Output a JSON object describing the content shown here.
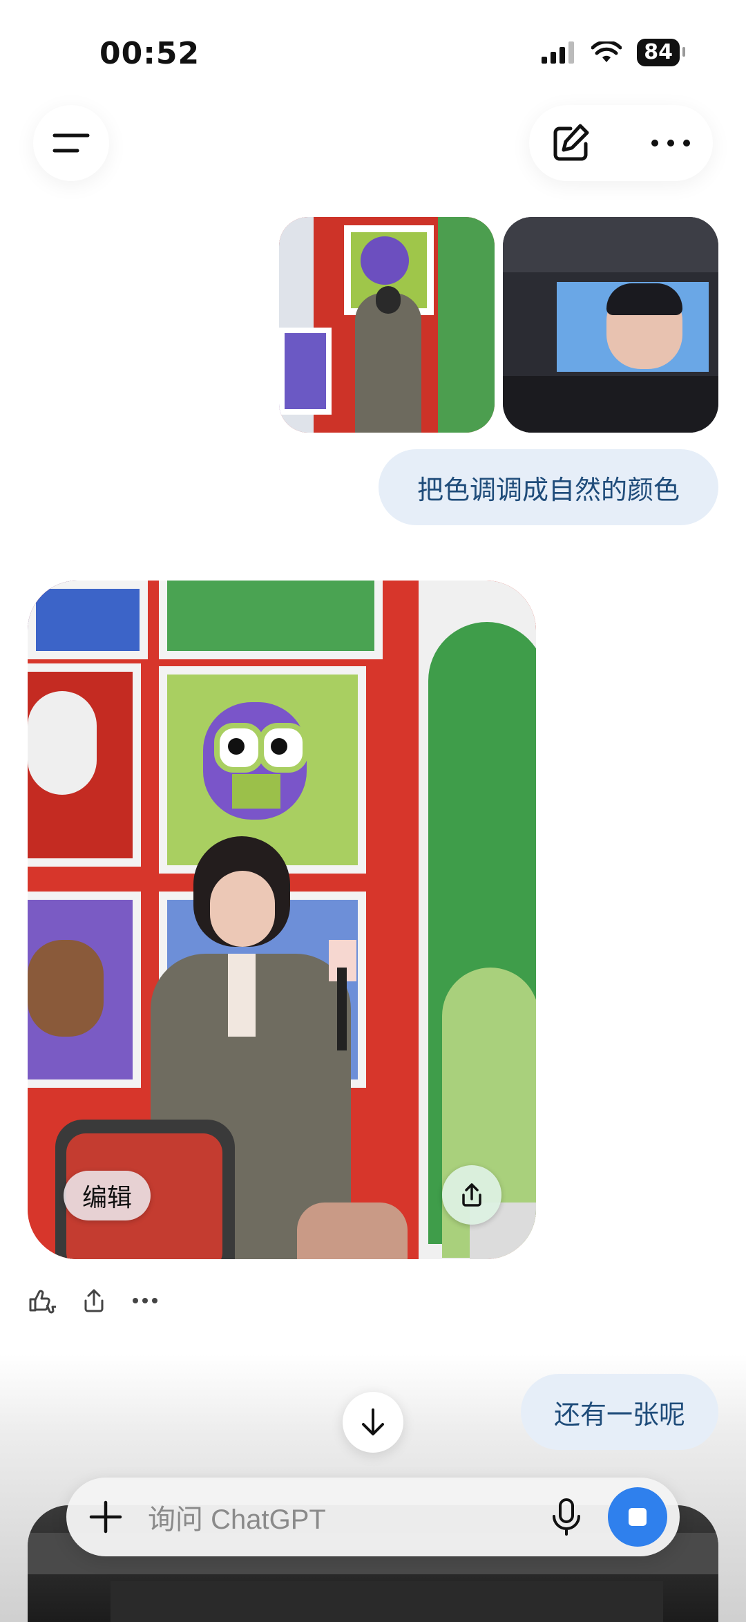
{
  "status": {
    "time": "00:52",
    "battery": "84"
  },
  "messages": {
    "user_text_1": "把色调调成自然的颜色",
    "user_text_2": "还有一张呢"
  },
  "image_overlay": {
    "edit_label": "编辑"
  },
  "composer": {
    "placeholder": "询问 ChatGPT"
  },
  "icons": {
    "menu": "menu-icon",
    "new_chat": "compose-icon",
    "more": "more-icon",
    "share": "share-icon",
    "feedback": "thumbs-icon",
    "scroll_down": "arrow-down-icon",
    "add": "plus-icon",
    "mic": "mic-icon",
    "stop": "stop-icon"
  }
}
